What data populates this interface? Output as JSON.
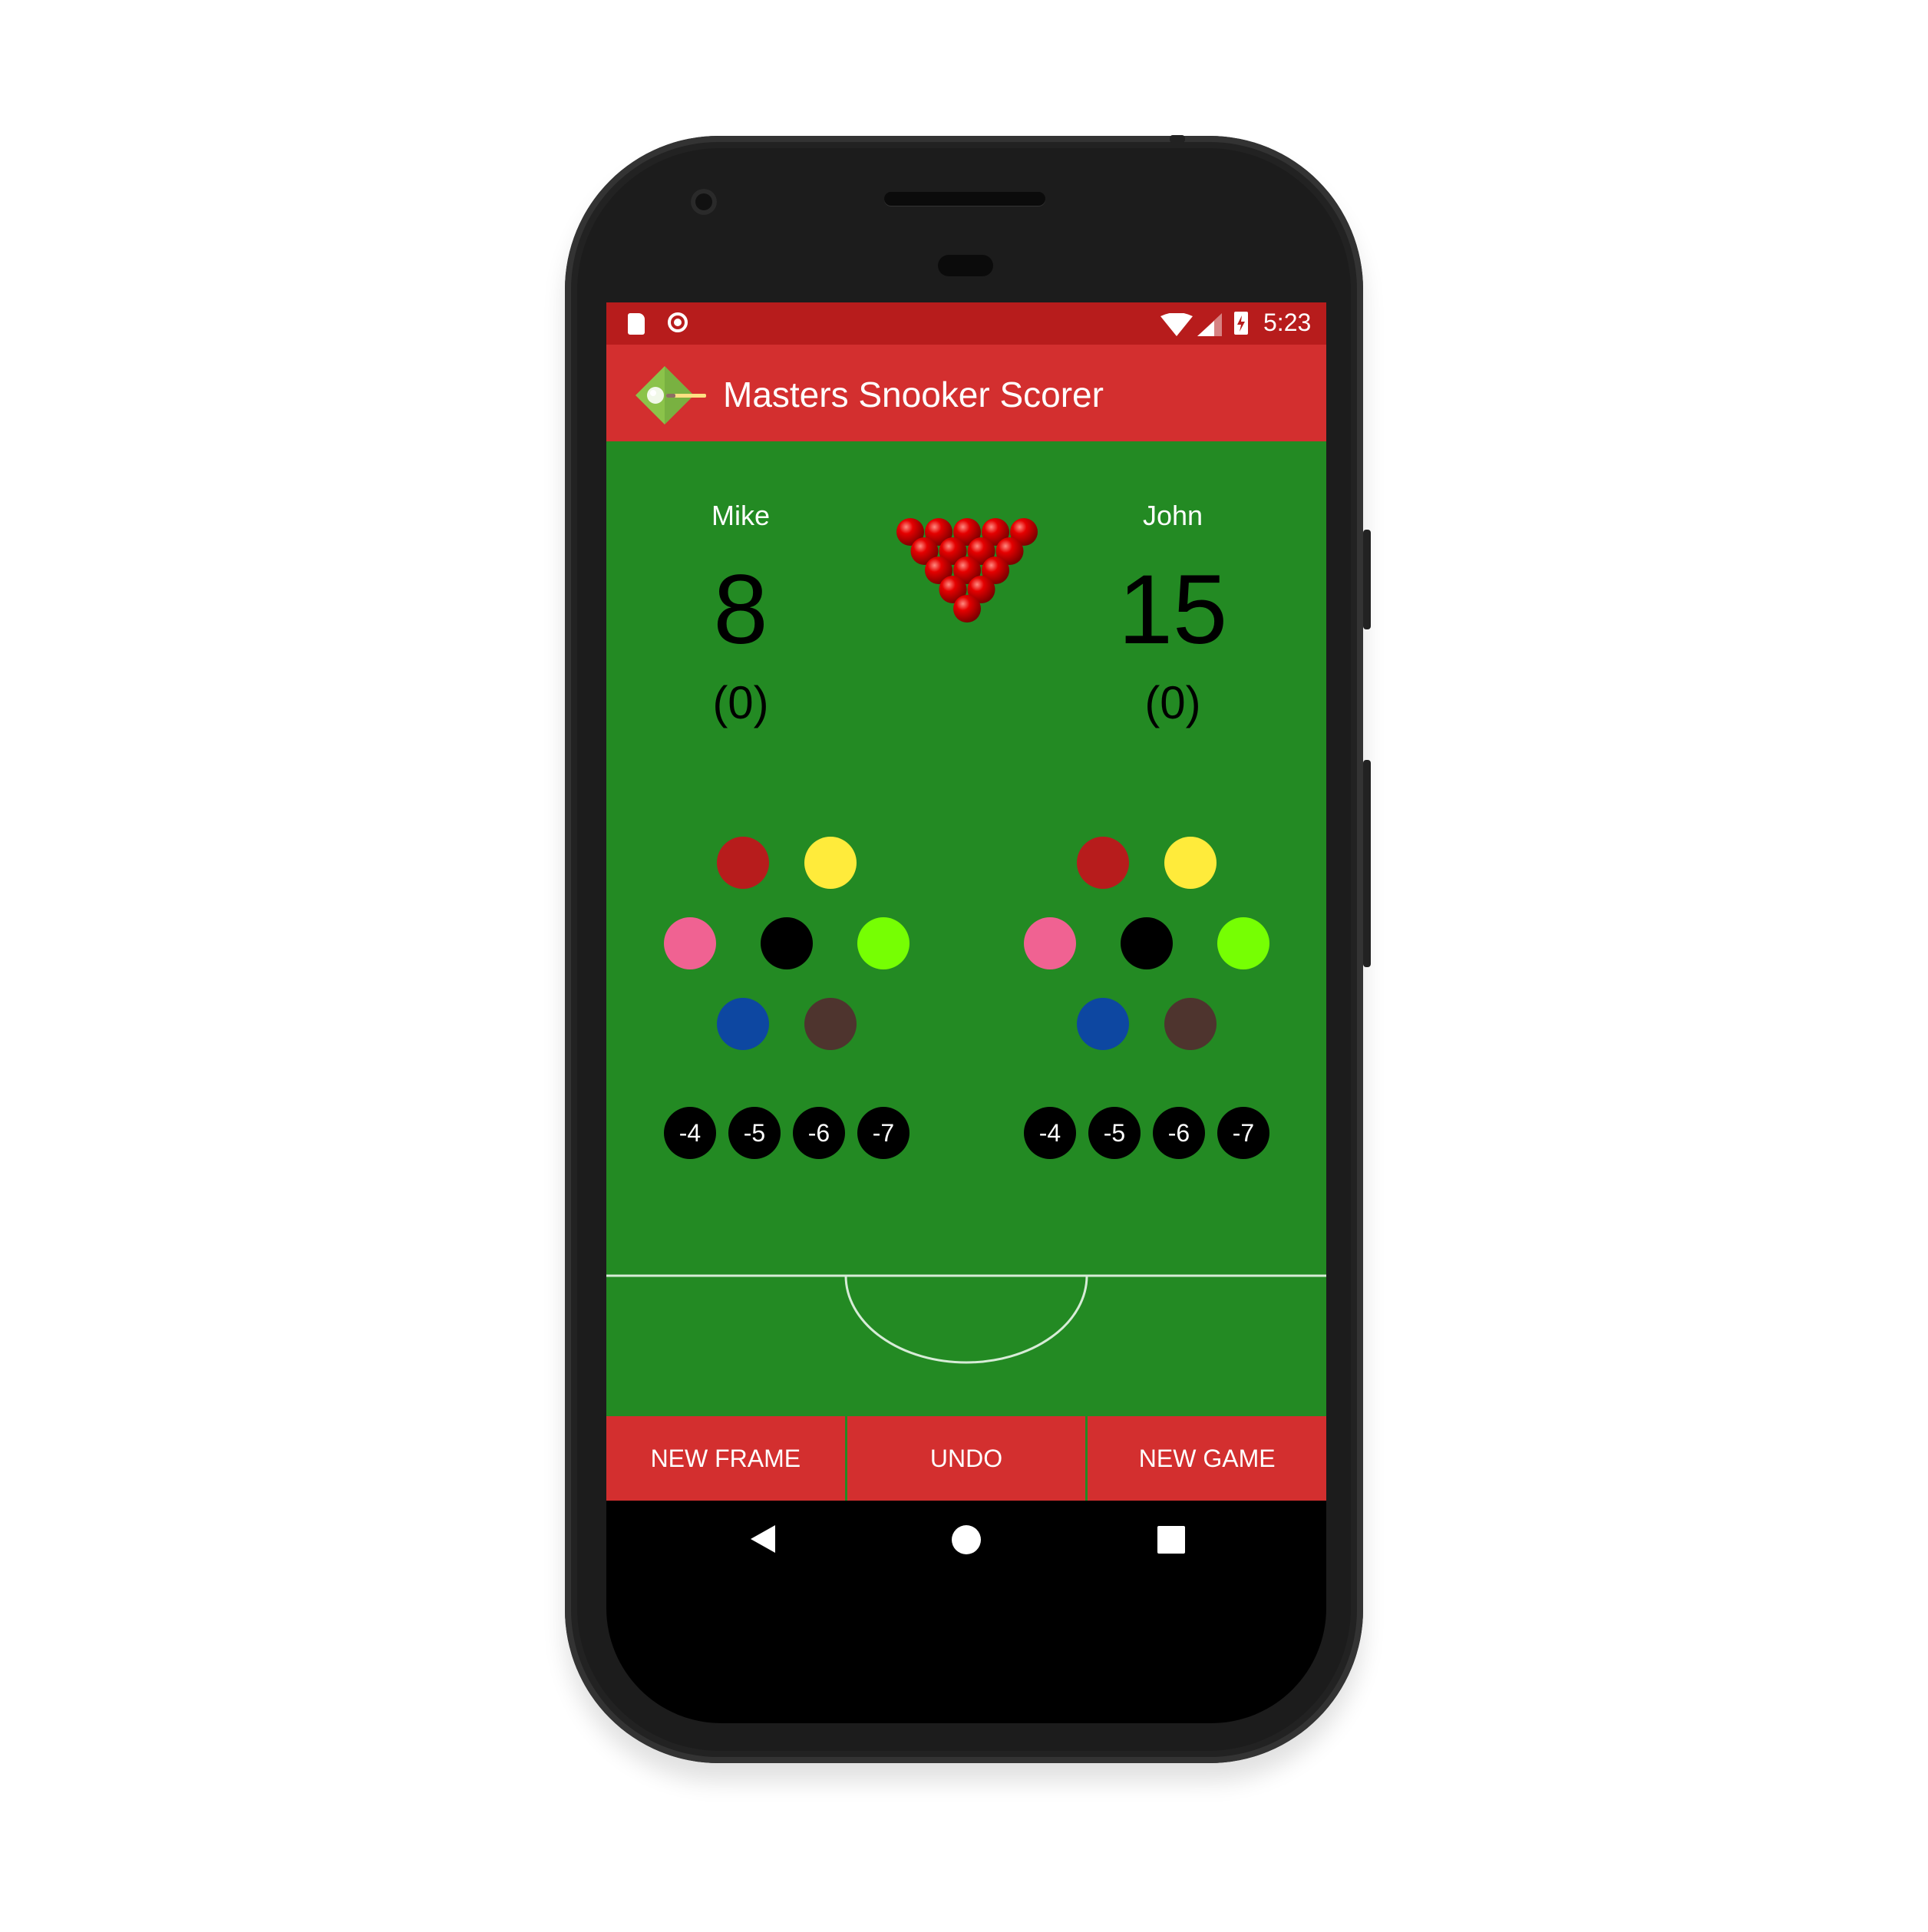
{
  "status_bar": {
    "time": "5:23",
    "left_icons": [
      "sd-card-icon",
      "record-icon"
    ],
    "right_icons": [
      "wifi-icon",
      "signal-icon",
      "battery-charging-icon"
    ]
  },
  "app_bar": {
    "title": "Masters Snooker Scorer",
    "logo_icon": "snooker-logo-icon"
  },
  "players": [
    {
      "name": "Mike",
      "score": "8",
      "frames": "(0)"
    },
    {
      "name": "John",
      "score": "15",
      "frames": "(0)"
    }
  ],
  "rack_icon": "red-balls-triangle-icon",
  "balls": [
    {
      "name": "red",
      "color": "#b71c1c"
    },
    {
      "name": "yellow",
      "color": "#ffeb3b"
    },
    {
      "name": "pink",
      "color": "#f06292"
    },
    {
      "name": "black",
      "color": "#000000"
    },
    {
      "name": "green",
      "color": "#76ff03"
    },
    {
      "name": "blue",
      "color": "#0d47a1"
    },
    {
      "name": "brown",
      "color": "#4e342e"
    }
  ],
  "fouls": [
    "-4",
    "-5",
    "-6",
    "-7"
  ],
  "actions": {
    "new_frame": "NEW FRAME",
    "undo": "UNDO",
    "new_game": "NEW GAME"
  },
  "nav": [
    "back-icon",
    "home-icon",
    "recents-icon"
  ],
  "colors": {
    "status_bar": "#b71c1c",
    "app_bar": "#d32f2f",
    "table_green": "#238a23"
  }
}
